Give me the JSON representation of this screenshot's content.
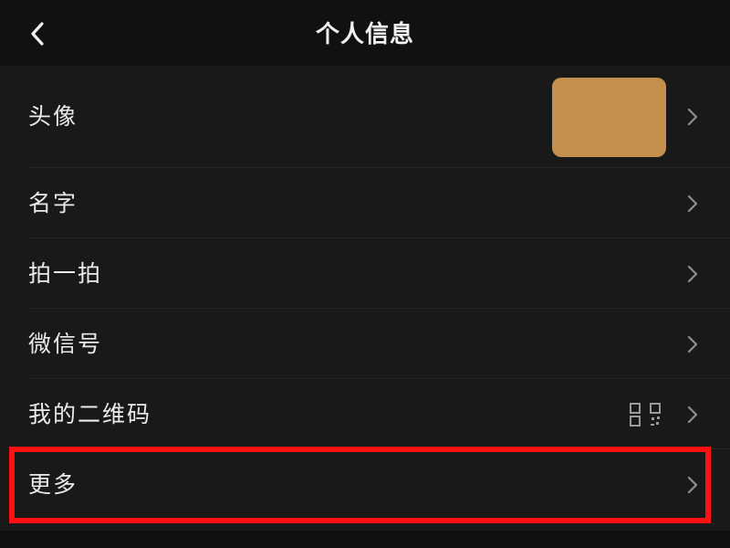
{
  "header": {
    "title": "个人信息"
  },
  "rows": [
    {
      "label": "头像",
      "has_avatar": true
    },
    {
      "label": "名字"
    },
    {
      "label": "拍一拍"
    },
    {
      "label": "微信号"
    },
    {
      "label": "我的二维码",
      "trailing_icon": "qr-code-icon"
    },
    {
      "label": "更多",
      "highlighted": true
    }
  ],
  "colors": {
    "background": "#111111",
    "list_background": "#191919",
    "text": "#eaeaea",
    "divider": "#262626",
    "chevron": "#8f8f8f",
    "avatar": "#c58f4d",
    "highlight": "#ff1111"
  },
  "icons": {
    "back": "back-chevron-icon",
    "row_arrow": "chevron-right-icon",
    "qr": "qr-code-icon"
  }
}
